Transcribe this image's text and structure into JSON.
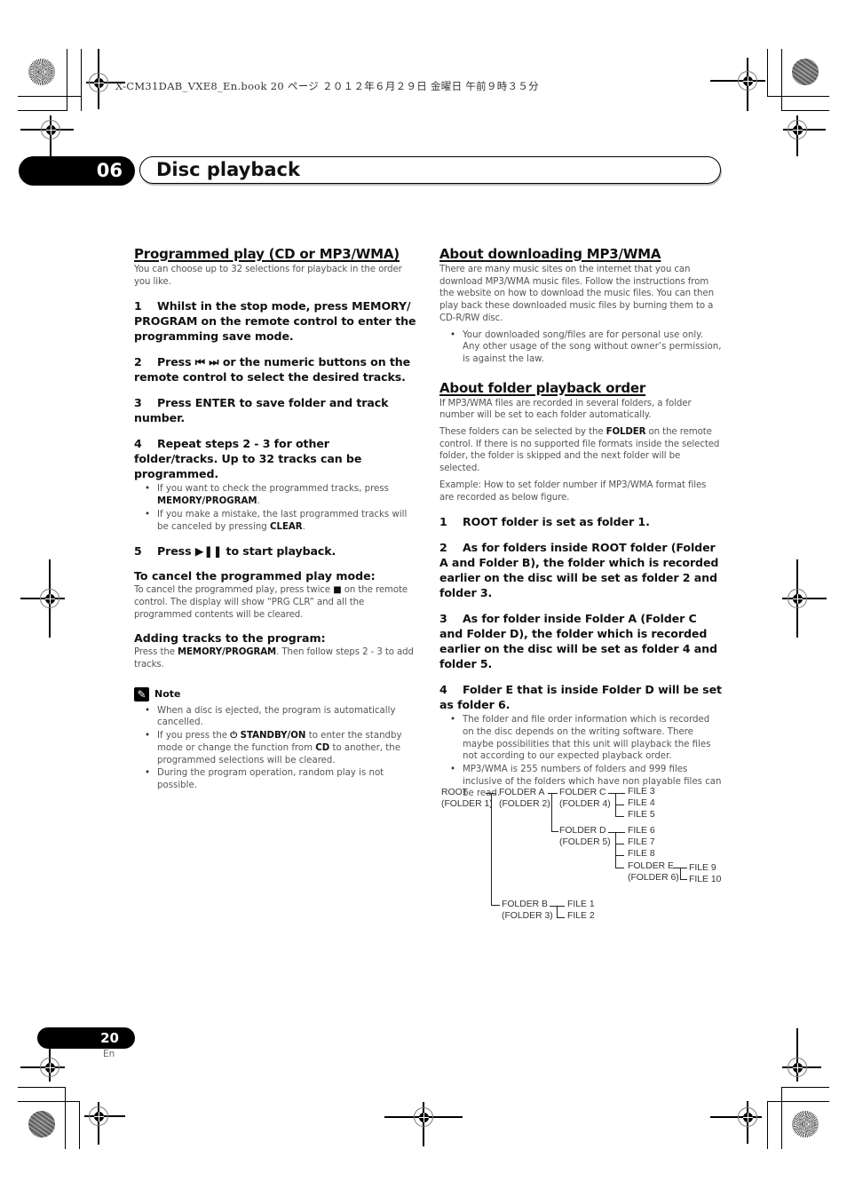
{
  "print_header": {
    "book_line": "X-CM31DAB_VXE8_En.book  20 ページ  ２０１２年６月２９日  金曜日  午前９時３５分"
  },
  "chapter": {
    "number": "06",
    "title": "Disc playback"
  },
  "left_column": {
    "section_title": "Programmed play (CD or MP3/WMA)",
    "intro": "You can choose up to 32 selections for playback in the order you like.",
    "steps": [
      {
        "num": "1",
        "text": "Whilst in the stop mode, press MEMORY/ PROGRAM on the remote control to enter the programming save mode."
      },
      {
        "num": "2",
        "pre": "Press ",
        "glyphs": "⏮ ⏭",
        "post": " or the numeric buttons on the remote control to select the desired tracks."
      },
      {
        "num": "3",
        "text": "Press ENTER to save folder and track number."
      },
      {
        "num": "4",
        "text": "Repeat steps 2 - 3 for other folder/tracks. Up to 32 tracks can be programmed."
      },
      {
        "num": "5",
        "pre": "Press ",
        "glyphs": "▶❚❚",
        "post": " to start playback."
      }
    ],
    "step4_bullets": [
      {
        "pre": "If you want to check the programmed tracks, press ",
        "bold": "MEMORY/PROGRAM",
        "post": "."
      },
      {
        "pre": "If you make a mistake, the last programmed tracks will be canceled by pressing ",
        "bold": "CLEAR",
        "post": "."
      }
    ],
    "cancel": {
      "title": "To cancel the programmed play mode:",
      "pre": "To cancel the programmed play, press twice ",
      "glyph": "■",
      "post": " on the remote control. The display will show “PRG CLR” and all the programmed contents will be cleared."
    },
    "adding": {
      "title": "Adding tracks to the program:",
      "pre": "Press the ",
      "bold": "MEMORY/PROGRAM",
      "post": ". Then follow steps 2 - 3 to add tracks."
    },
    "note": {
      "label": "Note",
      "icon": "pencil-icon",
      "items": [
        {
          "text": "When a disc is ejected, the program is automatically cancelled."
        },
        {
          "pre": "If you press the ",
          "glyph": "⏻",
          "bold1": "STANDBY/ON",
          "mid": " to enter the standby mode or change the function from ",
          "bold2": "CD",
          "post": " to another, the programmed selections will be cleared."
        },
        {
          "text": "During the program operation, random play is not possible."
        }
      ]
    }
  },
  "right_column": {
    "download": {
      "title": "About downloading MP3/WMA",
      "body": "There are many music sites on the internet that you can download MP3/WMA music files. Follow the instructions from the website on how to download the music files. You can then play back these downloaded music files by burning them to a CD-R/RW disc.",
      "bullets": [
        "Your downloaded song/files are for personal use only. Any other usage of the song without owner’s permission, is against the law."
      ]
    },
    "folder_order": {
      "title": "About folder playback order",
      "p1": "If MP3/WMA files are recorded in several folders, a folder number will be set to each folder automatically.",
      "p2_pre": "These folders can be selected by the ",
      "p2_bold": "FOLDER",
      "p2_post": " on the remote control. If there is no supported file formats inside the selected folder, the folder is skipped and the next folder will be selected.",
      "p3": "Example: How to set folder number if MP3/WMA format files are recorded as below figure.",
      "steps": [
        {
          "num": "1",
          "text": "ROOT folder is set as folder 1."
        },
        {
          "num": "2",
          "text": "As for folders inside ROOT folder (Folder A and Folder B), the folder which is recorded earlier on the disc will be set as folder 2 and folder 3."
        },
        {
          "num": "3",
          "text": "As for folder inside Folder A (Folder C and Folder D), the folder which is recorded earlier on the disc will be set as folder 4 and folder 5."
        },
        {
          "num": "4",
          "text": "Folder E that is inside Folder D will be set as folder 6."
        }
      ],
      "bullets": [
        "The folder and file order information which is recorded on the disc depends on the writing software. There maybe possibilities that this unit will playback the files not according to our expected playback order.",
        "MP3/WMA is 255 numbers of folders and 999 files inclusive of the folders which have non playable files can be read."
      ]
    },
    "tree": {
      "root": [
        "ROOT",
        "(FOLDER 1)"
      ],
      "folder_a": [
        "FOLDER A",
        "(FOLDER 2)"
      ],
      "folder_b": [
        "FOLDER B",
        "(FOLDER 3)"
      ],
      "folder_c": [
        "FOLDER C",
        "(FOLDER 4)"
      ],
      "folder_d": [
        "FOLDER D",
        "(FOLDER 5)"
      ],
      "folder_e": [
        "FOLDER E",
        "(FOLDER 6)"
      ],
      "files_c": [
        "FILE 3",
        "FILE 4",
        "FILE 5"
      ],
      "files_d": [
        "FILE 6",
        "FILE 7",
        "FILE 8"
      ],
      "files_e": [
        "FILE 9",
        "FILE 10"
      ],
      "files_b": [
        "FILE 1",
        "FILE 2"
      ]
    }
  },
  "footer": {
    "page_number": "20",
    "language": "En"
  }
}
